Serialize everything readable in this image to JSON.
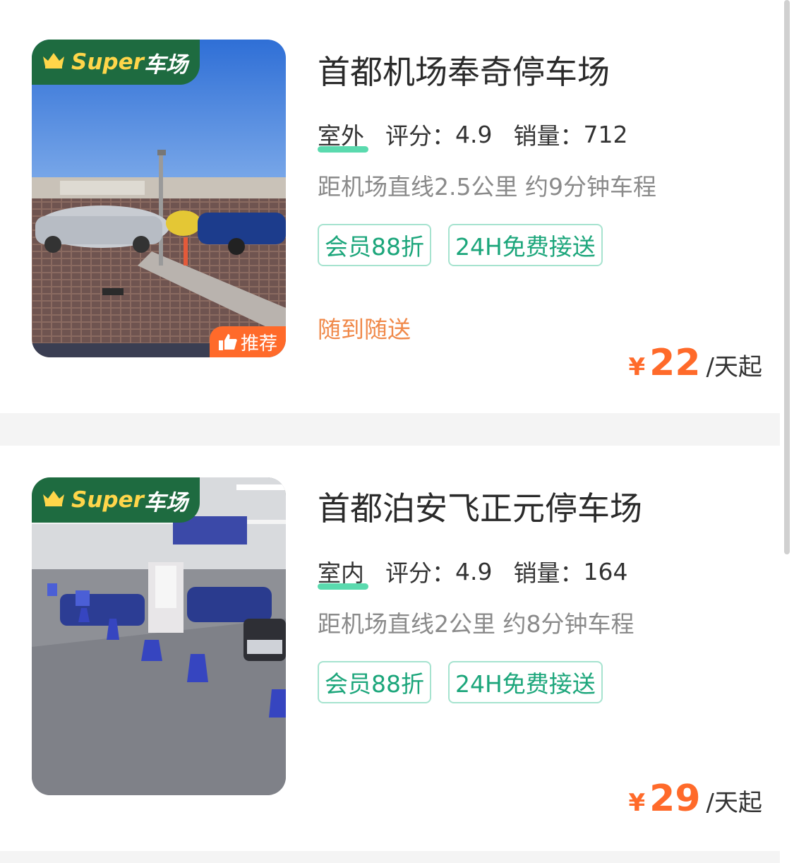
{
  "listings": [
    {
      "badge": {
        "crown_icon": "crown-icon",
        "super_word": "Super",
        "suffix": "车场"
      },
      "recommend_label": "推荐",
      "title": "首都机场奉奇停车场",
      "location_type": "室外",
      "rating_label": "评分：",
      "rating": "4.9",
      "sales_label": "销量：",
      "sales": "712",
      "distance": "距机场直线2.5公里 约9分钟车程",
      "tags": [
        "会员88折",
        "24H免费接送"
      ],
      "service": "随到随送",
      "price": {
        "currency": "¥",
        "amount": "22",
        "unit": "/天起"
      }
    },
    {
      "badge": {
        "crown_icon": "crown-icon",
        "super_word": "Super",
        "suffix": "车场"
      },
      "title": "首都泊安飞正元停车场",
      "location_type": "室内",
      "rating_label": "评分：",
      "rating": "4.9",
      "sales_label": "销量：",
      "sales": "164",
      "distance": "距机场直线2公里 约8分钟车程",
      "tags": [
        "会员88折",
        "24H免费接送"
      ],
      "price": {
        "currency": "¥",
        "amount": "29",
        "unit": "/天起"
      }
    }
  ],
  "colors": {
    "brand_green": "#1e6b40",
    "badge_gold": "#ffd64a",
    "accent_orange": "#ff6a2a",
    "tag_green": "#1ca67b",
    "service_orange": "#f0894a"
  }
}
